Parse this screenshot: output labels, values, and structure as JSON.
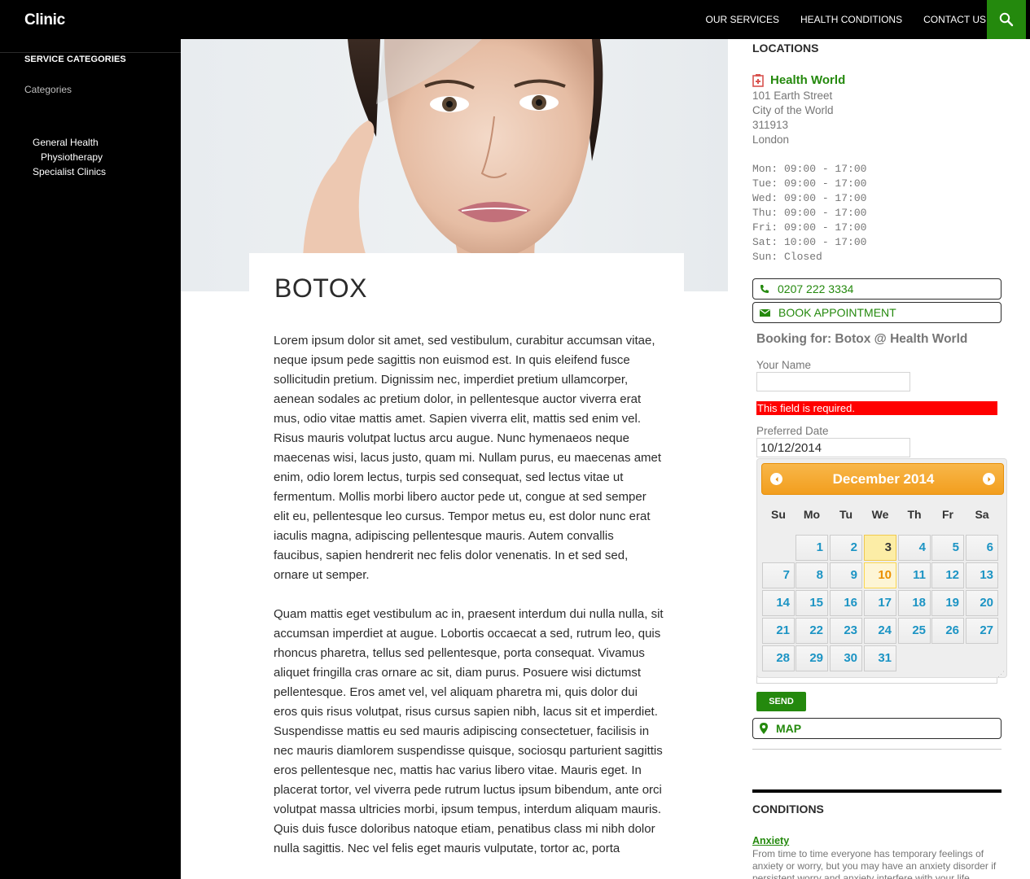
{
  "site": {
    "title": "Clinic"
  },
  "nav": {
    "items": [
      "OUR SERVICES",
      "HEALTH CONDITIONS",
      "CONTACT US"
    ],
    "search_icon": "search-icon"
  },
  "sidebar": {
    "title": "SERVICE CATEGORIES",
    "categories_label": "Categories",
    "links": [
      "General Health",
      "Physiotherapy",
      "Specialist Clinics"
    ]
  },
  "page": {
    "title": "BOTOX",
    "paragraphs": [
      "Lorem ipsum dolor sit amet, sed vestibulum, curabitur accumsan vitae, neque ipsum pede sagittis non euismod est. In quis eleifend fusce sollicitudin pretium. Dignissim nec, imperdiet pretium ullamcorper, aenean sodales ac pretium dolor, in pellentesque auctor viverra erat mus, odio vitae mattis amet. Sapien viverra elit, mattis sed enim vel. Risus mauris volutpat luctus arcu augue. Nunc hymenaeos neque maecenas wisi, lacus justo, quam mi. Nullam purus, eu maecenas amet enim, odio lorem lectus, turpis sed consequat, sed lectus vitae ut fermentum. Mollis morbi libero auctor pede ut, congue at sed semper elit eu, pellentesque leo cursus. Tempor metus eu, est dolor nunc erat iaculis magna, adipiscing pellentesque mauris. Autem convallis faucibus, sapien hendrerit nec felis dolor venenatis. In et sed sed, ornare ut semper.",
      "Quam mattis eget vestibulum ac in, praesent interdum dui nulla nulla, sit accumsan imperdiet at augue. Lobortis occaecat a sed, rutrum leo, quis rhoncus pharetra, tellus sed pellentesque, porta consequat. Vivamus aliquet fringilla cras ornare ac sit, diam purus. Posuere wisi dictumst pellentesque. Eros amet vel, vel aliquam pharetra mi, quis dolor dui eros quis risus volutpat, risus cursus sapien nibh, lacus sit et imperdiet. Suspendisse mattis eu sed mauris adipiscing consectetuer, facilisis in nec mauris diamlorem suspendisse quisque, sociosqu parturient sagittis eros pellentesque nec, mattis hac varius libero vitae. Mauris eget. In placerat tortor, vel viverra pede rutrum luctus ipsum bibendum, ante orci volutpat massa ultricies morbi, ipsum tempus, interdum aliquam mauris. Quis duis fusce doloribus natoque etiam, penatibus class mi nibh dolor nulla sagittis. Nec vel felis eget mauris vulputate, tortor ac, porta"
    ]
  },
  "locations": {
    "title": "LOCATIONS",
    "name": "Health World",
    "address": [
      "101 Earth Street",
      "City of the World",
      "311913",
      "London"
    ],
    "hours": [
      "Mon: 09:00 - 17:00",
      "Tue: 09:00 - 17:00",
      "Wed: 09:00 - 17:00",
      "Thu: 09:00 - 17:00",
      "Fri: 09:00 - 17:00",
      "Sat: 10:00 - 17:00",
      "Sun: Closed"
    ],
    "phone": "0207 222 3334",
    "book_label": "BOOK APPOINTMENT",
    "map_label": "MAP"
  },
  "booking": {
    "heading": "Booking for: Botox @ Health World",
    "name_label": "Your Name",
    "name_value": "",
    "error": "This field is required.",
    "date_label": "Preferred Date",
    "date_value": "10/12/2014",
    "send_label": "SEND"
  },
  "datepicker": {
    "title": "December 2014",
    "weekdays": [
      "Su",
      "Mo",
      "Tu",
      "We",
      "Th",
      "Fr",
      "Sa"
    ],
    "first_weekday_index": 1,
    "days_in_month": 31,
    "today": 3,
    "selected": 10
  },
  "conditions": {
    "title": "CONDITIONS",
    "link": "Anxiety",
    "text": "From time to time everyone has temporary feelings of anxiety or worry, but you may have an anxiety disorder if persistent worry and anxiety interfere with your life."
  },
  "colors": {
    "accent": "#24890d",
    "error": "#ff0000",
    "datepicker_header": "#f29e1e"
  }
}
